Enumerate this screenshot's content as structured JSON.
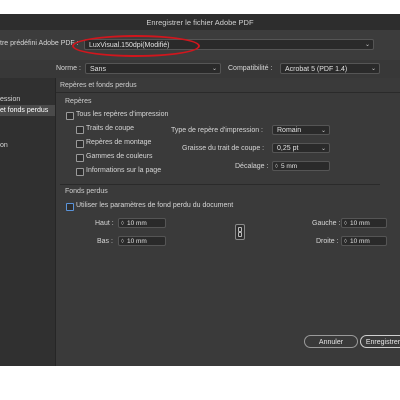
{
  "window": {
    "title": "Enregistrer le fichier Adobe PDF"
  },
  "preset": {
    "label": "tre prédéfini Adobe PDF :",
    "value": "LuxVisual.150dpi(Modifié)"
  },
  "standard": {
    "label": "Norme :",
    "value": "Sans"
  },
  "compat": {
    "label": "Compatibilité :",
    "value": "Acrobat 5 (PDF 1.4)"
  },
  "sidebar": {
    "items": [
      {
        "label": "ession"
      },
      {
        "label": "et fonds perdus"
      },
      {
        "label": "on"
      }
    ]
  },
  "panel": {
    "title": "Repères et fonds perdus",
    "marks": {
      "section": "Repères",
      "all": "Tous les repères d'impression",
      "crop": "Traits de coupe",
      "reg": "Repères de montage",
      "color": "Gammes de couleurs",
      "info": "Informations sur la page",
      "type_label": "Type de repère d'impression :",
      "type_value": "Romain",
      "weight_label": "Graisse du trait de coupe :",
      "weight_value": "0,25 pt",
      "offset_label": "Décalage :",
      "offset_value": "5 mm"
    },
    "bleed": {
      "section": "Fonds perdus",
      "use_doc": "Utiliser les paramètres de fond perdu du document",
      "top_label": "Haut :",
      "top_value": "10 mm",
      "bottom_label": "Bas :",
      "bottom_value": "10 mm",
      "left_label": "Gauche :",
      "left_value": "10 mm",
      "right_label": "Droite :",
      "right_value": "10 mm"
    }
  },
  "buttons": {
    "cancel": "Annuler",
    "save": "Enregistrer"
  },
  "colors": {
    "highlight": "#d1161d",
    "accent": "#5a93d9"
  }
}
